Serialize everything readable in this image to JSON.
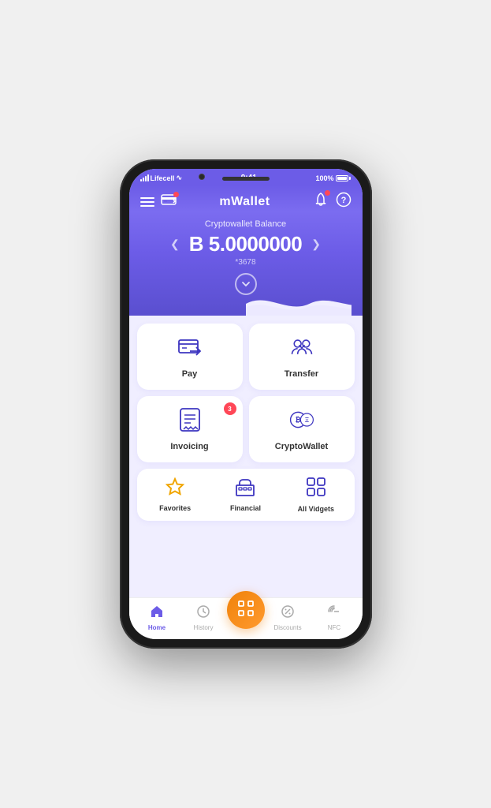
{
  "device": {
    "carrier": "Lifecell",
    "time": "9:41",
    "battery": "100%"
  },
  "header": {
    "title": "mWallet",
    "hamburger_label": "menu",
    "card_label": "cards",
    "bell_label": "notifications",
    "help_label": "help"
  },
  "balance": {
    "label": "Cryptowallet Balance",
    "currency_symbol": "В",
    "amount": "5.0000000",
    "account_mask": "*3678",
    "expand_label": "expand"
  },
  "actions": [
    {
      "id": "pay",
      "label": "Pay",
      "badge": null
    },
    {
      "id": "transfer",
      "label": "Transfer",
      "badge": null
    },
    {
      "id": "invoicing",
      "label": "Invoicing",
      "badge": "3"
    },
    {
      "id": "cryptowallet",
      "label": "CryptoWallet",
      "badge": null
    }
  ],
  "shortcuts": [
    {
      "id": "favorites",
      "label": "Favorites",
      "color": "orange"
    },
    {
      "id": "financial",
      "label": "Financial",
      "color": "blue"
    },
    {
      "id": "all_widgets",
      "label": "All Vidgets",
      "color": "blue"
    }
  ],
  "nav": [
    {
      "id": "home",
      "label": "Home",
      "active": true
    },
    {
      "id": "history",
      "label": "History",
      "active": false
    },
    {
      "id": "scan",
      "label": "",
      "active": false,
      "center": true
    },
    {
      "id": "discounts",
      "label": "Discounts",
      "active": false
    },
    {
      "id": "nfc",
      "label": "NFC",
      "active": false
    }
  ]
}
